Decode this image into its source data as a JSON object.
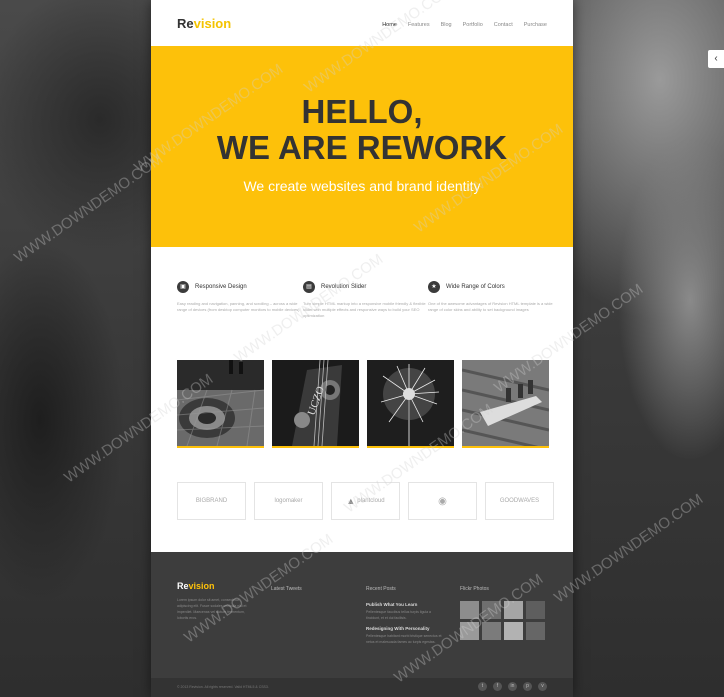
{
  "brand": {
    "logo_prefix": "Re",
    "logo_suffix": "vision"
  },
  "nav": [
    "Home",
    "Features",
    "Blog",
    "Portfolio",
    "Contact",
    "Purchase"
  ],
  "hero": {
    "line1": "HELLO,",
    "line2": "WE ARE REWORK",
    "tagline": "We create websites and brand identity"
  },
  "features": [
    {
      "title": "Responsive Design",
      "text": "Easy reading and navigation, panning, and scrolling – across a wide range of devices (from desktop computer monitors to mobile devices)"
    },
    {
      "title": "Revolution Slider",
      "text": "Turn simple HTML markup into a responsive mobile friendly & flexible slider with multiple effects and responsive ways to build your SEO optimization"
    },
    {
      "title": "Wide Range of Colors",
      "text": "One of the awesome advantages of Revision HTML template is a wide range of color skins and ability to set background images"
    }
  ],
  "partners": [
    "BIGBRAND",
    "logomaker",
    "plantcloud",
    "",
    "GOODWAVES"
  ],
  "footer": {
    "about_text": "Lorem ipsum dolor sit amet, consectetur adipiscing elit. Fusce sodales vehicula nisl et imperdiet. Maecenas vel dictum fermentum, lobortis eros.",
    "tweets_title": "Latest Tweets",
    "posts_title": "Recent Posts",
    "posts": [
      {
        "title": "Publish What You Learn",
        "text": "Pellentesque faucibus tellus turpis ligula a tincidunt, et et dui facilisis."
      },
      {
        "title": "Redesigning With Personality",
        "text": "Pellentesque habitant morbi tristique senectus et netus et malesuada fames ac turpis egestas."
      }
    ],
    "flickr_title": "Flickr Photos",
    "copyright": "© 2013 Revision. All rights reserved. Valid HTML5 & CSS3."
  },
  "watermark": "WWW.DOWNDEMO.COM",
  "colors": {
    "accent": "#fdc10a",
    "dark": "#333333",
    "footer": "#3d3d3d"
  }
}
